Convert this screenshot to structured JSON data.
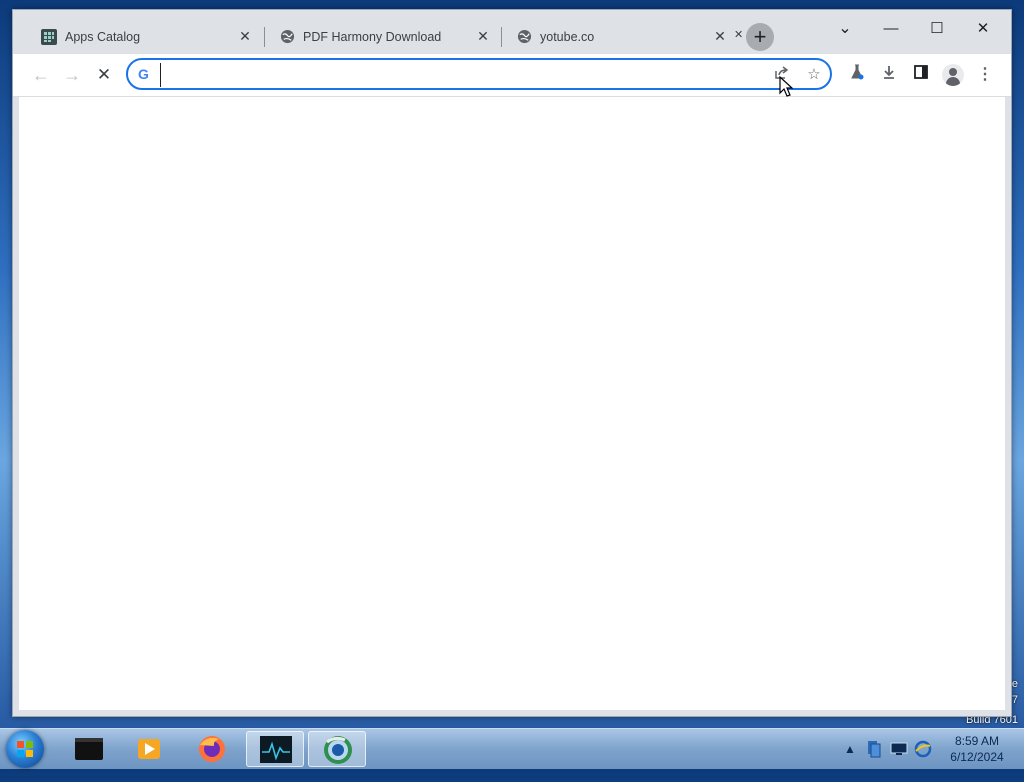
{
  "browser": {
    "tabs": [
      {
        "title": "Apps Catalog",
        "favicon": "apps-grid-icon"
      },
      {
        "title": "PDF Harmony Download",
        "favicon": "globe-icon"
      },
      {
        "title": "yotube.co",
        "favicon": "globe-icon"
      }
    ],
    "new_tab_symbol": "+",
    "omnibox": {
      "value": "",
      "placeholder": "",
      "engine_symbol": "G"
    },
    "window_controls": {
      "minimize": "—",
      "maximize": "☐",
      "close": "✕",
      "tab_search": "⌄"
    }
  },
  "desktop": {
    "right_edge_fragments": [
      "e",
      "7"
    ],
    "build_text": "Build 7601"
  },
  "taskbar": {
    "clock": {
      "time": "8:59 AM",
      "date": "6/12/2024"
    },
    "tray_expand_symbol": "▲"
  },
  "colors": {
    "accent": "#1a73e8",
    "tabstrip": "#dee1e6",
    "taskbar": "#7ea3cc"
  }
}
